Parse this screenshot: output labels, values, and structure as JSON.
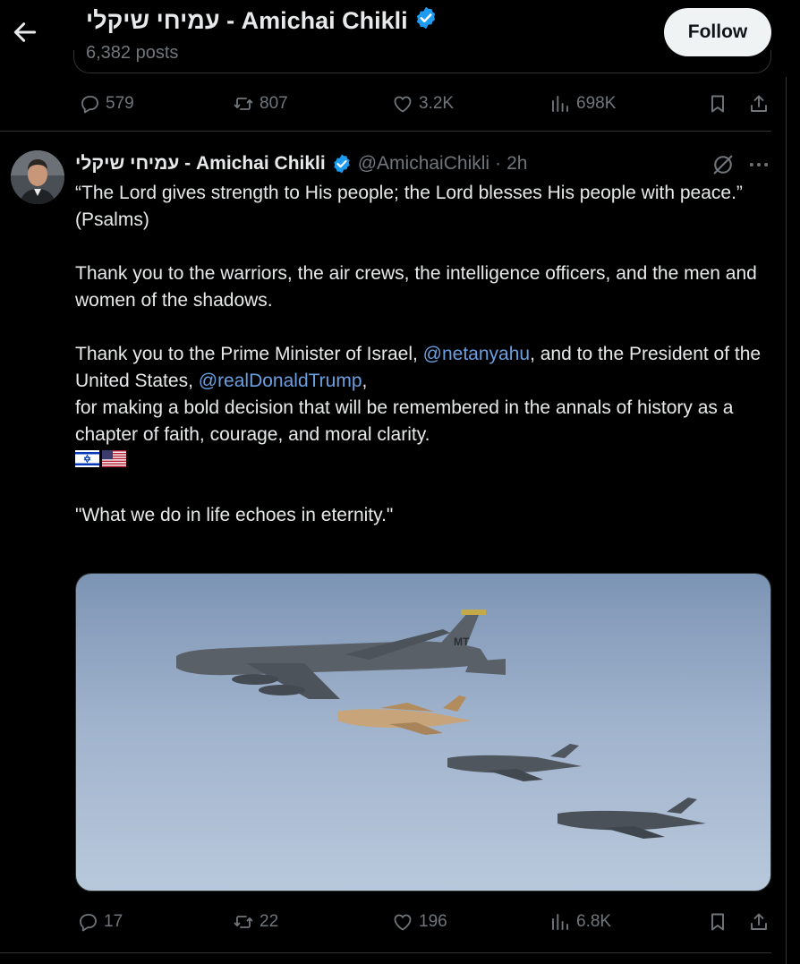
{
  "header": {
    "name": "עמיחי שיקלי - Amichai Chikli",
    "posts": "6,382 posts",
    "follow_label": "Follow"
  },
  "top_actions": {
    "replies": "579",
    "reposts": "807",
    "likes": "3.2K",
    "views": "698K"
  },
  "tweet": {
    "name": "עמיחי שיקלי - Amichai Chikli",
    "handle": "@AmichaiChikli",
    "separator": "·",
    "time": "2h",
    "lines": {
      "quote1": "“The Lord gives strength to His people; the Lord blesses His people with peace.”",
      "quote2": "(Psalms)",
      "thanks1": "Thank you to the warriors, the air crews, the intelligence officers, and the men and women of the shadows.",
      "thanks2_pre": "Thank you to the Prime Minister of Israel, ",
      "mention1": "@netanyahu",
      "thanks2_mid": ", and to the President of the United States, ",
      "mention2": "@realDonaldTrump",
      "thanks2_post": ",",
      "thanks3": "for making a bold decision that will be remembered in the annals of history as a chapter of faith, courage, and moral clarity.",
      "closing": "\"What we do in life echoes in eternity.\""
    },
    "flags": [
      "flag-israel",
      "flag-usa"
    ],
    "media_alt": "B-52 bomber flying with three fighter jets"
  },
  "bottom_actions": {
    "replies": "17",
    "reposts": "22",
    "likes": "196",
    "views": "6.8K"
  },
  "colors": {
    "background": "#000000",
    "text": "#e7e9ea",
    "muted": "#71767b",
    "mention": "#6b9fe0",
    "verified": "#1d9bf0",
    "follow_bg": "#eff3f4"
  }
}
